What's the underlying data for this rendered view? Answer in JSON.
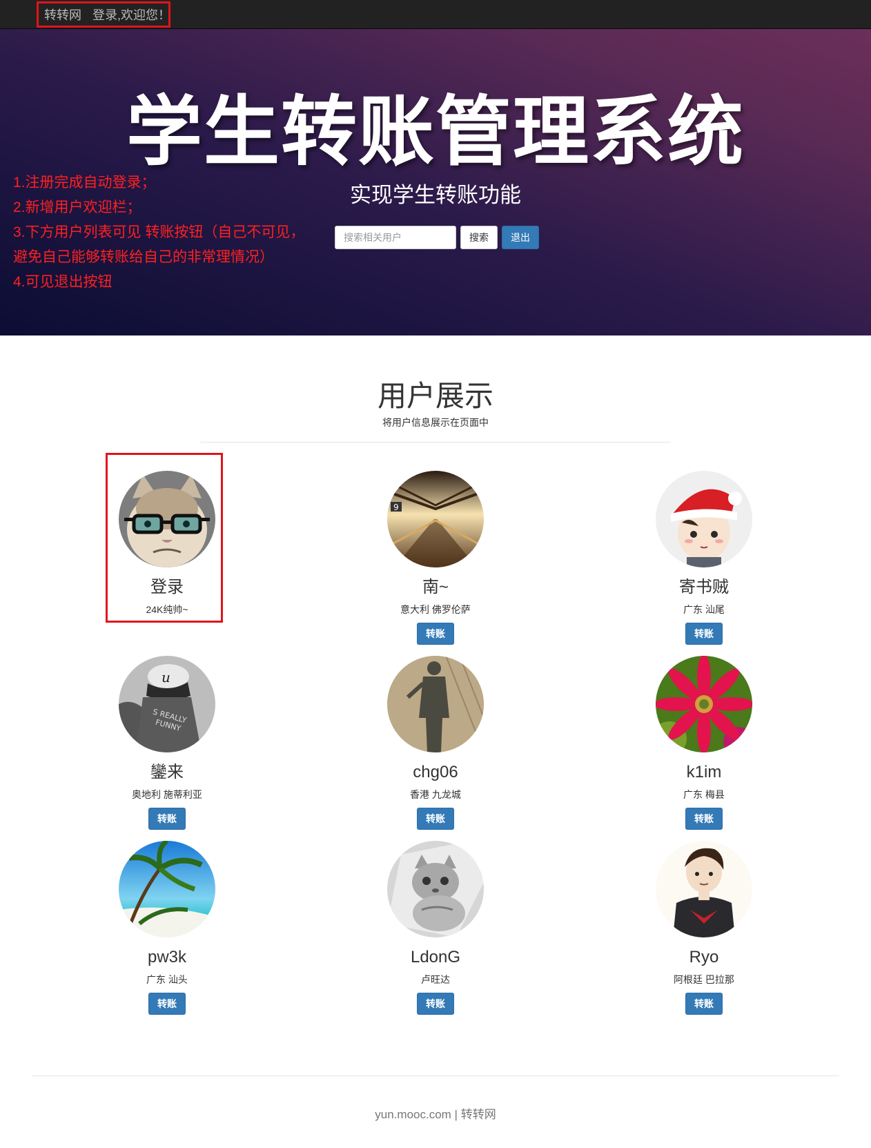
{
  "navbar": {
    "brand": "转转网",
    "welcome": "登录,欢迎您！"
  },
  "hero": {
    "title": "学生转账管理系统",
    "subtitle": "实现学生转账功能",
    "notes": [
      "1.注册完成自动登录；",
      "2.新增用户欢迎栏；",
      "3.下方用户列表可见 转账按钮（自己不可见，",
      "避免自己能够转账给自己的非常理情况）",
      "4.可见退出按钮"
    ],
    "search_placeholder": "搜索相关用户",
    "search_button": "搜索",
    "logout_button": "退出"
  },
  "users_section": {
    "title": "用户展示",
    "subtitle": "将用户信息展示在页面中",
    "transfer_label": "转账",
    "users": [
      {
        "name": "登录",
        "location": "24K纯帅~",
        "avatar": "grumpy-cat-avatar",
        "is_self": true
      },
      {
        "name": "南~",
        "location": "意大利 佛罗伦萨",
        "avatar": "train-station-avatar",
        "is_self": false
      },
      {
        "name": "寄书贼",
        "location": "广东 汕尾",
        "avatar": "santa-hat-cartoon-avatar",
        "is_self": false
      },
      {
        "name": "鑾来",
        "location": "奥地利 施蒂利亚",
        "avatar": "cap-girl-avatar",
        "is_self": false
      },
      {
        "name": "chg06",
        "location": "香港 九龙城",
        "avatar": "shadow-avatar",
        "is_self": false
      },
      {
        "name": "k1im",
        "location": "广东 梅县",
        "avatar": "red-flower-avatar",
        "is_self": false
      },
      {
        "name": "pw3k",
        "location": "广东 汕头",
        "avatar": "palm-beach-avatar",
        "is_self": false
      },
      {
        "name": "LdonG",
        "location": "卢旺达",
        "avatar": "kitten-avatar",
        "is_self": false
      },
      {
        "name": "Ryo",
        "location": "阿根廷 巴拉那",
        "avatar": "cartoon-boy-avatar",
        "is_self": false
      }
    ]
  },
  "footer": {
    "text": "yun.mooc.com | 转转网"
  },
  "colors": {
    "navbar_bg": "#222222",
    "annotation_red": "#e0141b",
    "primary_button": "#337ab7"
  }
}
